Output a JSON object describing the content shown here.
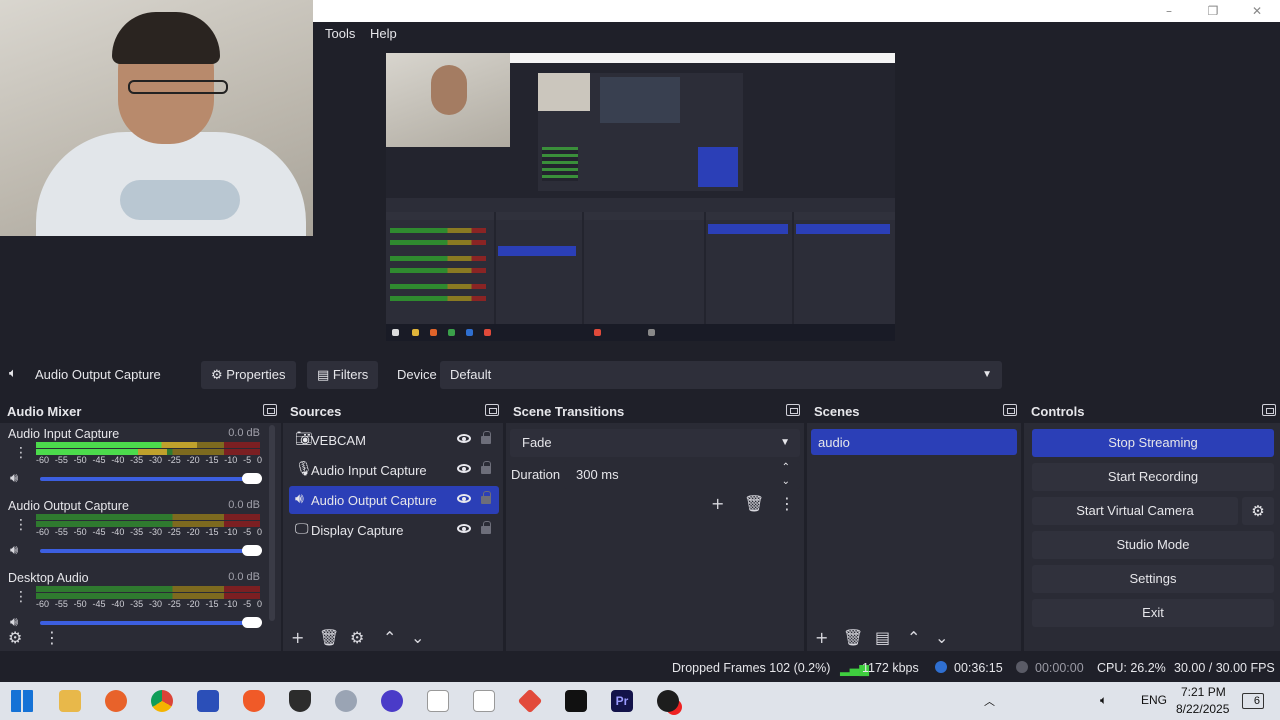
{
  "window": {
    "minimize": "–",
    "restore": "❐",
    "close": "✕"
  },
  "menu": [
    "Tools",
    "Help"
  ],
  "source_toolbar": {
    "source_name": "Audio Output Capture",
    "properties": "Properties",
    "filters": "Filters",
    "device_label": "Device",
    "device_value": "Default"
  },
  "audio_mixer": {
    "title": "Audio Mixer",
    "scale": [
      "-60",
      "-55",
      "-50",
      "-45",
      "-40",
      "-35",
      "-30",
      "-25",
      "-20",
      "-15",
      "-10",
      "-5",
      "0"
    ],
    "channels": [
      {
        "name": "Audio Input Capture",
        "db": "0.0 dB",
        "level": 0.72
      },
      {
        "name": "Audio Output Capture",
        "db": "0.0 dB",
        "level": 0.0
      },
      {
        "name": "Desktop Audio",
        "db": "0.0 dB",
        "level": 0.0
      }
    ]
  },
  "sources": {
    "title": "Sources",
    "items": [
      {
        "name": "VEBCAM",
        "icon": "camera-icon"
      },
      {
        "name": "Audio Input Capture",
        "icon": "microphone-icon"
      },
      {
        "name": "Audio Output Capture",
        "icon": "speaker-icon",
        "selected": true
      },
      {
        "name": "Display Capture",
        "icon": "monitor-icon"
      }
    ]
  },
  "scene_transitions": {
    "title": "Scene Transitions",
    "transition": "Fade",
    "duration_label": "Duration",
    "duration_value": "300 ms"
  },
  "scenes": {
    "title": "Scenes",
    "items": [
      "audio"
    ]
  },
  "controls": {
    "title": "Controls",
    "stop_streaming": "Stop Streaming",
    "start_recording": "Start Recording",
    "start_virtual_camera": "Start Virtual Camera",
    "studio_mode": "Studio Mode",
    "settings": "Settings",
    "exit": "Exit"
  },
  "status": {
    "dropped_frames": "Dropped Frames 102 (0.2%)",
    "bitrate": "1172 kbps",
    "stream_time": "00:36:15",
    "record_time": "00:00:00",
    "cpu": "CPU: 26.2%",
    "fps": "30.00 / 30.00 FPS"
  },
  "taskbar": {
    "language": "ENG",
    "time": "7:21 PM",
    "date": "8/22/2025",
    "notifications": "6"
  },
  "colors": {
    "accent": "#2b3fb7",
    "panel": "#2a2b35",
    "background": "#1f2029"
  }
}
